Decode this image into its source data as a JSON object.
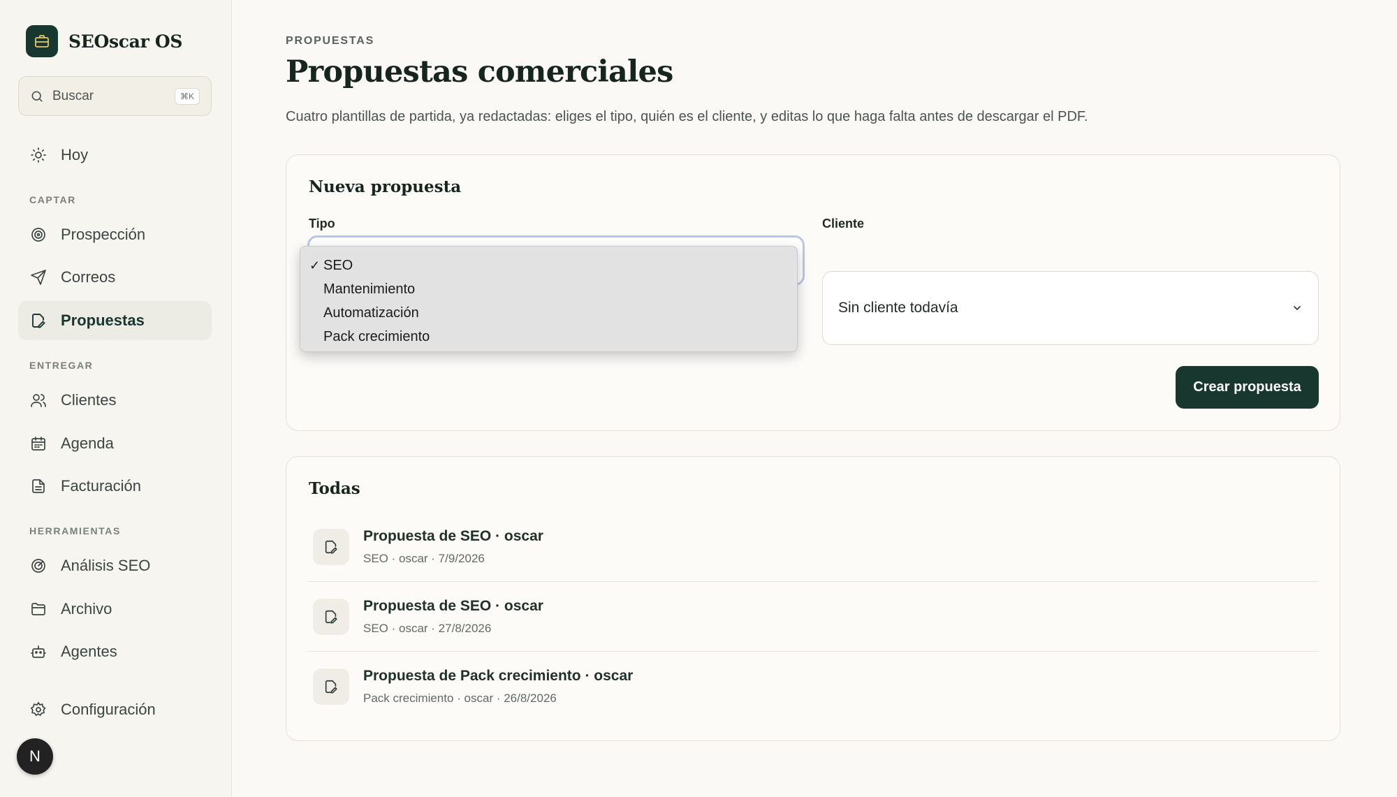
{
  "app": {
    "name": "SEOscar OS"
  },
  "search": {
    "placeholder": "Buscar",
    "shortcut": "⌘K"
  },
  "nav": {
    "today": "Hoy",
    "sections": {
      "captar": "CAPTAR",
      "entregar": "ENTREGAR",
      "herramientas": "HERRAMIENTAS"
    },
    "items": {
      "prospeccion": "Prospección",
      "correos": "Correos",
      "propuestas": "Propuestas",
      "clientes": "Clientes",
      "agenda": "Agenda",
      "facturacion": "Facturación",
      "analisis_seo": "Análisis SEO",
      "archivo": "Archivo",
      "agentes": "Agentes",
      "configuracion": "Configuración"
    },
    "active": "propuestas",
    "avatar_letter": "N"
  },
  "page": {
    "eyebrow": "PROPUESTAS",
    "title": "Propuestas comerciales",
    "subtitle": "Cuatro plantillas de partida, ya redactadas: eliges el tipo, quién es el cliente, y editas lo que haga falta antes de descargar el PDF."
  },
  "new_proposal": {
    "title": "Nueva propuesta",
    "tipo_label": "Tipo",
    "cliente_label": "Cliente",
    "tipo_options": [
      "SEO",
      "Mantenimiento",
      "Automatización",
      "Pack crecimiento"
    ],
    "tipo_selected": "SEO",
    "check_mark": "✓",
    "cliente_value": "Sin cliente todavía",
    "create_button": "Crear propuesta"
  },
  "all": {
    "title": "Todas",
    "items": [
      {
        "title": "Propuesta de SEO · oscar",
        "meta": "SEO · oscar · 7/9/2026"
      },
      {
        "title": "Propuesta de SEO · oscar",
        "meta": "SEO · oscar · 27/8/2026"
      },
      {
        "title": "Propuesta de Pack crecimiento · oscar",
        "meta": "Pack crecimiento · oscar · 26/8/2026"
      }
    ]
  },
  "colors": {
    "accent": "#17372f",
    "background": "#faf9f5",
    "sidebar": "#f6f5f0"
  }
}
